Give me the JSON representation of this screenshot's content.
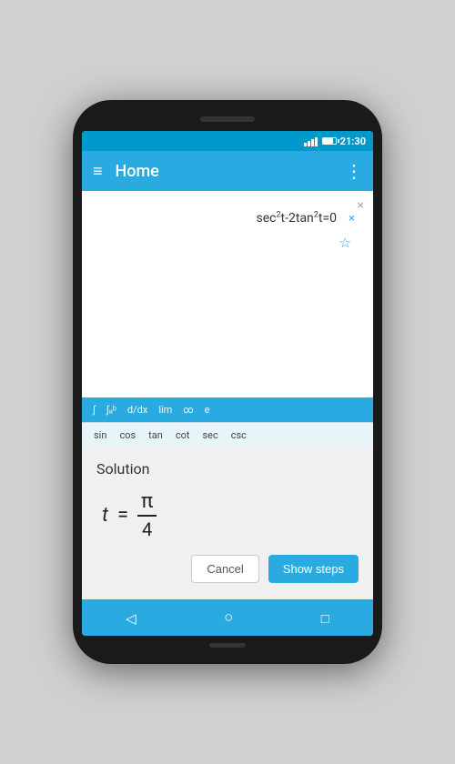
{
  "statusBar": {
    "time": "21:30"
  },
  "appBar": {
    "title": "Home"
  },
  "expression": {
    "text": "sec²t-2tan²t=0",
    "clearAllLabel": "×",
    "closeLabel": "×",
    "starLabel": "☆"
  },
  "keyboard": {
    "topRow": [
      "∫",
      "∫ₐᵇ",
      "d/dx",
      "lim",
      "∞",
      "e"
    ],
    "bottomRow": [
      "sin",
      "cos",
      "tan",
      "cot",
      "sec",
      "csc"
    ]
  },
  "solution": {
    "label": "Solution",
    "variable": "t",
    "equals": "=",
    "numerator": "π",
    "denominator": "4"
  },
  "buttons": {
    "cancel": "Cancel",
    "showSteps": "Show steps"
  },
  "navBar": {
    "back": "back",
    "home": "home",
    "recent": "recent"
  }
}
